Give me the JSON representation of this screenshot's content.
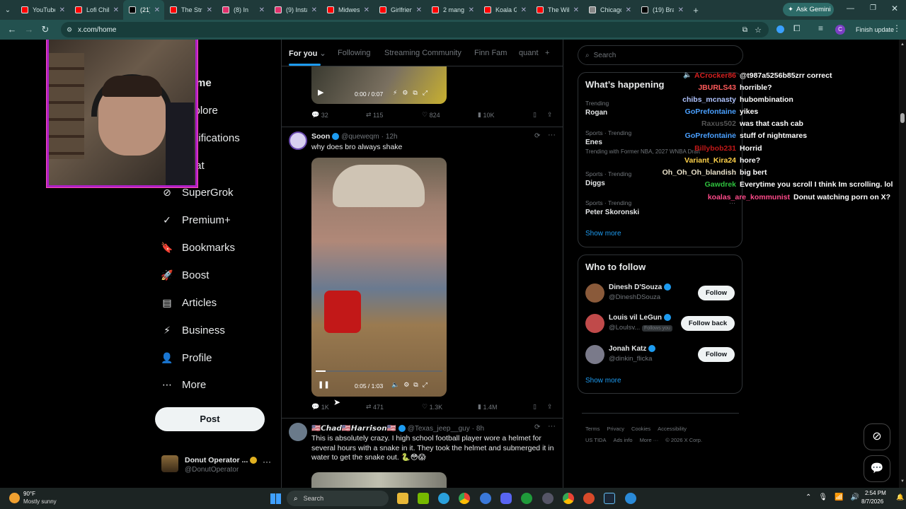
{
  "tabs": [
    {
      "label": "YouTube",
      "color": "#ff0000"
    },
    {
      "label": "Lofi Chill",
      "color": "#ff0000"
    },
    {
      "label": "(21) ",
      "color": "#000000",
      "active": true
    },
    {
      "label": "The Stru",
      "color": "#ff0000"
    },
    {
      "label": "(8) In",
      "color": "#e1306c"
    },
    {
      "label": "(9) Insta",
      "color": "#e1306c"
    },
    {
      "label": "Midwest",
      "color": "#ff0000"
    },
    {
      "label": "Girlfrien",
      "color": "#ff0000"
    },
    {
      "label": "2 mang",
      "color": "#ff0000"
    },
    {
      "label": "Koala Ge",
      "color": "#ff0000"
    },
    {
      "label": "The Wik",
      "color": "#ff0000"
    },
    {
      "label": "Chicago",
      "color": "#888888"
    },
    {
      "label": "(19) Bra",
      "color": "#000000"
    }
  ],
  "ask_gemini": "Ask Gemini",
  "url": "x.com/home",
  "finish_update": "Finish update",
  "profile_letter": "C",
  "nav": [
    {
      "label": "Home",
      "icon": "home-icon"
    },
    {
      "label": "Explore",
      "icon": "search-icon"
    },
    {
      "label": "Notifications",
      "icon": "bell-icon"
    },
    {
      "label": "Chat",
      "icon": "chat-icon"
    },
    {
      "label": "SuperGrok",
      "icon": "grok-icon"
    },
    {
      "label": "Premium+",
      "icon": "premium-icon"
    },
    {
      "label": "Bookmarks",
      "icon": "bookmark-icon"
    },
    {
      "label": "Boost",
      "icon": "boost-icon"
    },
    {
      "label": "Articles",
      "icon": "articles-icon"
    },
    {
      "label": "Business",
      "icon": "lightning-icon"
    },
    {
      "label": "Profile",
      "icon": "person-icon"
    },
    {
      "label": "More",
      "icon": "more-icon"
    }
  ],
  "post_button": "Post",
  "account": {
    "name": "Donut Operator ...",
    "handle": "@DonutOperator"
  },
  "feed_tabs": [
    "For you",
    "Following",
    "Streaming Community",
    "Finn Fam",
    "quant"
  ],
  "post1": {
    "time": "0:00 / 0:07",
    "replies": "32",
    "reposts": "115",
    "likes": "824",
    "views": "10K"
  },
  "post2": {
    "name": "Soon",
    "handle": "@queweqm",
    "age": "12h",
    "text": "why does bro always shake",
    "time": "0:05 / 1:03",
    "replies": "1K",
    "reposts": "471",
    "likes": "1.3K",
    "views": "1.4M"
  },
  "post3": {
    "name": "🇺🇸𝘾𝙝𝙖𝙙🇺🇸𝙃𝙖𝙧𝙧𝙞𝙨𝙤𝙣🇺🇸",
    "handle": "@Texas_jeep__guy",
    "age": "8h",
    "text": "This is absolutely crazy. I high school football player wore a helmet for several hours with a snake in it. They took the helmet and submerged it in water to get the snake out. 🐍😳😱"
  },
  "search_placeholder": "Search",
  "whats_happening": {
    "title": "What’s happening",
    "trends": [
      {
        "meta": "Trending",
        "name": "Rogan",
        "extra": ""
      },
      {
        "meta": "Sports · Trending",
        "name": "Enes",
        "extra": "Trending with  Former NBA, 2027 WNBA Draft"
      },
      {
        "meta": "Sports · Trending",
        "name": "Diggs",
        "extra": ""
      },
      {
        "meta": "Sports · Trending",
        "name": "Peter Skoronski",
        "extra": ""
      }
    ],
    "show_more": "Show more"
  },
  "who_to_follow": {
    "title": "Who to follow",
    "users": [
      {
        "name": "Dinesh D'Souza",
        "handle": "@DineshDSouza",
        "button": "Follow",
        "follows_you": ""
      },
      {
        "name": "Louis vil LeGun",
        "handle": "@Loulsv...",
        "button": "Follow back",
        "follows_you": "Follows you"
      },
      {
        "name": "Jonah Katz",
        "handle": "@dinkin_flicka",
        "button": "Follow",
        "follows_you": ""
      }
    ],
    "show_more": "Show more"
  },
  "footer": [
    "Terms",
    "Privacy",
    "Cookies",
    "Accessibility",
    "US TIDA",
    "Ads info",
    "More ···",
    "© 2026 X Corp."
  ],
  "chat": [
    {
      "user": "ACrocker86",
      "color": "#d62020",
      "msg": "@t987a5256b85zrr correct"
    },
    {
      "user": "JBURLS43",
      "color": "#ff5a5a",
      "msg": "horrible?"
    },
    {
      "user": "chibs_mcnasty",
      "color": "#b0c4ff",
      "msg": "hubombination"
    },
    {
      "user": "GoPrefontaine",
      "color": "#4aa0ff",
      "msg": "yikes"
    },
    {
      "user": "Raxus502",
      "color": "#555555",
      "msg": "was that cash cab"
    },
    {
      "user": "GoPrefontaine",
      "color": "#4aa0ff",
      "msg": "stuff of nightmares"
    },
    {
      "user": "Billybob231",
      "color": "#c01818",
      "msg": "Horrid"
    },
    {
      "user": "Variant_Kira24",
      "color": "#ffd24a",
      "msg": "hore?"
    },
    {
      "user": "Oh_Oh_Oh_blandish",
      "color": "#e8e0c8",
      "msg": "big bert"
    },
    {
      "user": "Gawdrek",
      "color": "#2fc13e",
      "msg": "Everytime you scroll I think Im scrolling. lol"
    },
    {
      "user": "koalas_are_kommunist",
      "color": "#ff4a8a",
      "msg": "Donut watching porn on X?"
    }
  ],
  "weather": {
    "temp": "90°F",
    "desc": "Mostly sunny"
  },
  "taskbar_search": "Search",
  "clock": {
    "time": "2:54 PM",
    "date": "8/7/2026"
  }
}
